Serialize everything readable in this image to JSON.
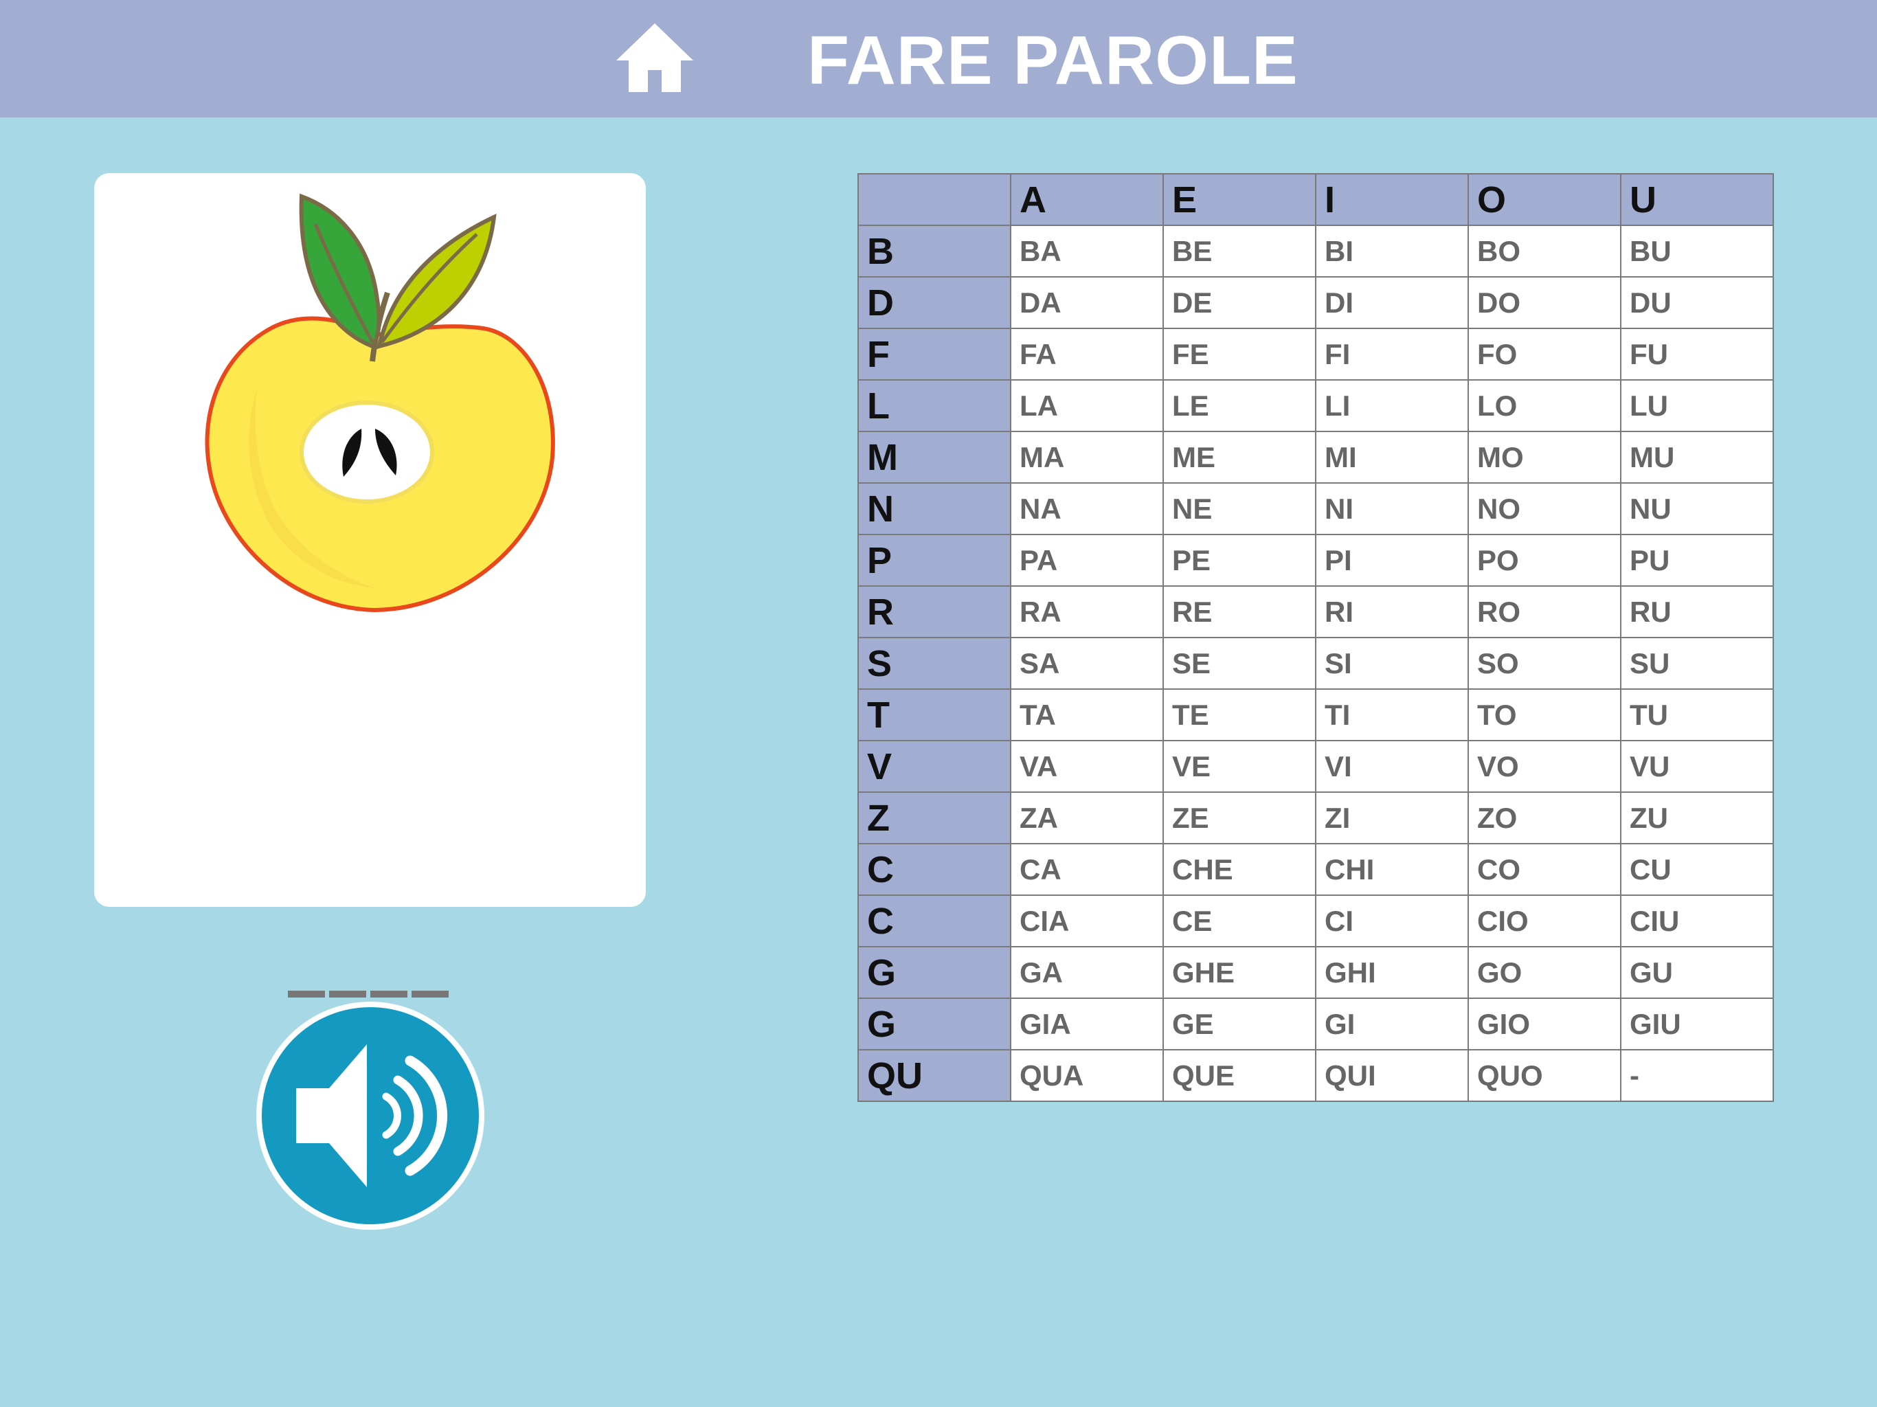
{
  "header": {
    "title": "FARE PAROLE",
    "home_icon": "home-icon",
    "background_color": "#a2add2"
  },
  "card": {
    "image_icon": "apple-icon",
    "blank_count": 4
  },
  "sound_button": {
    "icon": "speaker-icon",
    "color": "#1499c1"
  },
  "table": {
    "header_color": "#a2add2",
    "columns": [
      "",
      "A",
      "E",
      "I",
      "O",
      "U"
    ],
    "rows": [
      {
        "consonant": "B",
        "cells": [
          "BA",
          "BE",
          "BI",
          "BO",
          "BU"
        ]
      },
      {
        "consonant": "D",
        "cells": [
          "DA",
          "DE",
          "DI",
          "DO",
          "DU"
        ]
      },
      {
        "consonant": "F",
        "cells": [
          "FA",
          "FE",
          "FI",
          "FO",
          "FU"
        ]
      },
      {
        "consonant": "L",
        "cells": [
          "LA",
          "LE",
          "LI",
          "LO",
          "LU"
        ]
      },
      {
        "consonant": "M",
        "cells": [
          "MA",
          "ME",
          "MI",
          "MO",
          "MU"
        ]
      },
      {
        "consonant": "N",
        "cells": [
          "NA",
          "NE",
          "NI",
          "NO",
          "NU"
        ]
      },
      {
        "consonant": "P",
        "cells": [
          "PA",
          "PE",
          "PI",
          "PO",
          "PU"
        ]
      },
      {
        "consonant": "R",
        "cells": [
          "RA",
          "RE",
          "RI",
          "RO",
          "RU"
        ]
      },
      {
        "consonant": "S",
        "cells": [
          "SA",
          "SE",
          "SI",
          "SO",
          "SU"
        ]
      },
      {
        "consonant": "T",
        "cells": [
          "TA",
          "TE",
          "TI",
          "TO",
          "TU"
        ]
      },
      {
        "consonant": "V",
        "cells": [
          "VA",
          "VE",
          "VI",
          "VO",
          "VU"
        ]
      },
      {
        "consonant": "Z",
        "cells": [
          "ZA",
          "ZE",
          "ZI",
          "ZO",
          "ZU"
        ]
      },
      {
        "consonant": "C",
        "cells": [
          "CA",
          "CHE",
          "CHI",
          "CO",
          "CU"
        ]
      },
      {
        "consonant": "C",
        "cells": [
          "CIA",
          "CE",
          "CI",
          "CIO",
          "CIU"
        ]
      },
      {
        "consonant": "G",
        "cells": [
          "GA",
          "GHE",
          "GHI",
          "GO",
          "GU"
        ]
      },
      {
        "consonant": "G",
        "cells": [
          "GIA",
          "GE",
          "GI",
          "GIO",
          "GIU"
        ]
      },
      {
        "consonant": "QU",
        "cells": [
          "QUA",
          "QUE",
          "QUI",
          "QUO",
          "-"
        ]
      }
    ]
  }
}
